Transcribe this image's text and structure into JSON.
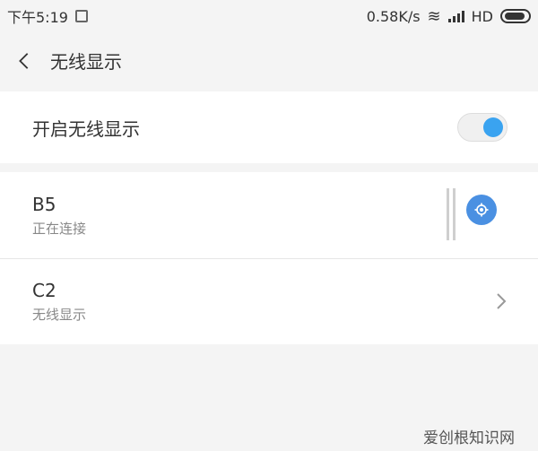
{
  "status": {
    "time": "下午5:19",
    "speed": "0.58K/s",
    "network": "HD"
  },
  "header": {
    "title": "无线显示"
  },
  "toggle": {
    "label": "开启无线显示",
    "state": "on"
  },
  "devices": [
    {
      "name": "B5",
      "status": "正在连接"
    },
    {
      "name": "C2",
      "status": "无线显示"
    }
  ],
  "watermark": "爱创根知识网",
  "colors": {
    "accent": "#3aa3f0",
    "settings": "#4a90e2"
  }
}
